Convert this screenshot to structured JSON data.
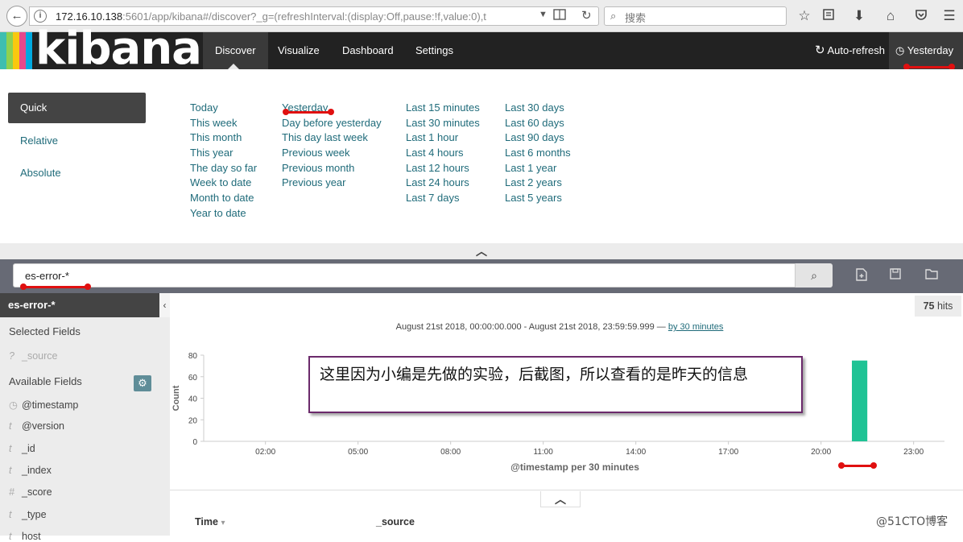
{
  "browser": {
    "url_main": "172.16.10.138",
    "url_rest": ":5601/app/kibana#/discover?_g=(refreshInterval:(display:Off,pause:!f,value:0),t",
    "search_placeholder": "搜索",
    "icons": [
      "back-icon",
      "info-icon",
      "dropdown-icon",
      "reader-icon",
      "reload-icon",
      "search-icon",
      "star-icon",
      "library-icon",
      "download-icon",
      "home-icon",
      "pocket-icon",
      "menu-icon"
    ]
  },
  "nav": {
    "logo": "kibana",
    "stripe_colors": [
      "#3ebeb0",
      "#8fd14f",
      "#f9c80e",
      "#e8488b",
      "#00a9e0"
    ],
    "items": [
      {
        "label": "Discover"
      },
      {
        "label": "Visualize"
      },
      {
        "label": "Dashboard"
      },
      {
        "label": "Settings"
      }
    ],
    "auto_refresh": "Auto-refresh",
    "time_label": "Yesterday"
  },
  "picker": {
    "tabs": [
      {
        "label": "Quick"
      },
      {
        "label": "Relative"
      },
      {
        "label": "Absolute"
      }
    ],
    "columns": [
      [
        "Today",
        "This week",
        "This month",
        "This year",
        "The day so far",
        "Week to date",
        "Month to date",
        "Year to date"
      ],
      [
        "Yesterday",
        "Day before yesterday",
        "This day last week",
        "Previous week",
        "Previous month",
        "Previous year"
      ],
      [
        "Last 15 minutes",
        "Last 30 minutes",
        "Last 1 hour",
        "Last 4 hours",
        "Last 12 hours",
        "Last 24 hours",
        "Last 7 days"
      ],
      [
        "Last 30 days",
        "Last 60 days",
        "Last 90 days",
        "Last 6 months",
        "Last 1 year",
        "Last 2 years",
        "Last 5 years"
      ]
    ]
  },
  "query": {
    "value": "es-error-*"
  },
  "sidebar": {
    "index": "es-error-*",
    "selected_heading": "Selected Fields",
    "selected_fields": [
      {
        "type": "?",
        "name": "_source"
      }
    ],
    "available_heading": "Available Fields",
    "available_fields": [
      {
        "type": "◷",
        "name": "@timestamp"
      },
      {
        "type": "t",
        "name": "@version"
      },
      {
        "type": "t",
        "name": "_id"
      },
      {
        "type": "t",
        "name": "_index"
      },
      {
        "type": "#",
        "name": "_score"
      },
      {
        "type": "t",
        "name": "_type"
      },
      {
        "type": "t",
        "name": "host"
      }
    ]
  },
  "results": {
    "hits_count": "75",
    "hits_label": "hits",
    "range_text": "August 21st 2018, 00:00:00.000 - August 21st 2018, 23:59:59.999 — ",
    "interval_link": "by 30 minutes",
    "callout": "这里因为小编是先做的实验，后截图，所以查看的是昨天的信息",
    "table_headers": {
      "time": "Time",
      "source": "_source"
    },
    "watermark": "@51CTO博客"
  },
  "chart_data": {
    "type": "bar",
    "ylabel": "Count",
    "xlabel": "@timestamp per 30 minutes",
    "ylim": [
      0,
      80
    ],
    "yticks": [
      0,
      20,
      40,
      60,
      80
    ],
    "xlim_hours": [
      0,
      24
    ],
    "xticks": [
      "02:00",
      "05:00",
      "08:00",
      "11:00",
      "14:00",
      "17:00",
      "20:00",
      "23:00"
    ],
    "bar_color": "#1fc395",
    "bars": [
      {
        "start_hour": 21.0,
        "value": 75
      }
    ]
  }
}
